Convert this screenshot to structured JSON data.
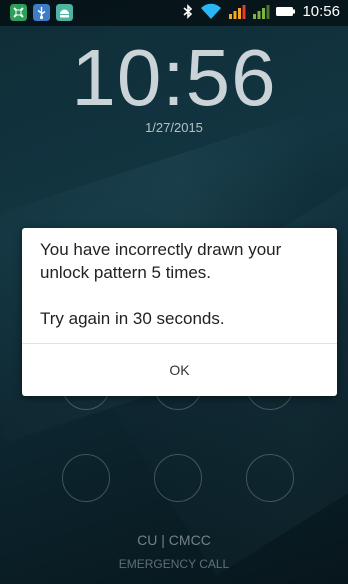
{
  "status_bar": {
    "time": "10:56",
    "notification_icons": [
      "app-notification-icon",
      "usb-icon",
      "android-debug-icon"
    ],
    "system_icons": [
      "bluetooth-icon",
      "wifi-icon",
      "signal-icon",
      "signal-icon",
      "battery-icon"
    ]
  },
  "lockscreen": {
    "clock": "10:56",
    "date": "1/27/2015",
    "carriers": "CU  |  CMCC",
    "emergency_call": "EMERGENCY CALL"
  },
  "dialog": {
    "message": "You have incorrectly drawn your unlock pattern 5 times.\n\nTry again in 30 seconds.",
    "ok_label": "OK"
  },
  "colors": {
    "background": "#0f2d37",
    "dialog": "#ffffff",
    "signal": "#f5a623",
    "wifi": "#29b6f6"
  }
}
